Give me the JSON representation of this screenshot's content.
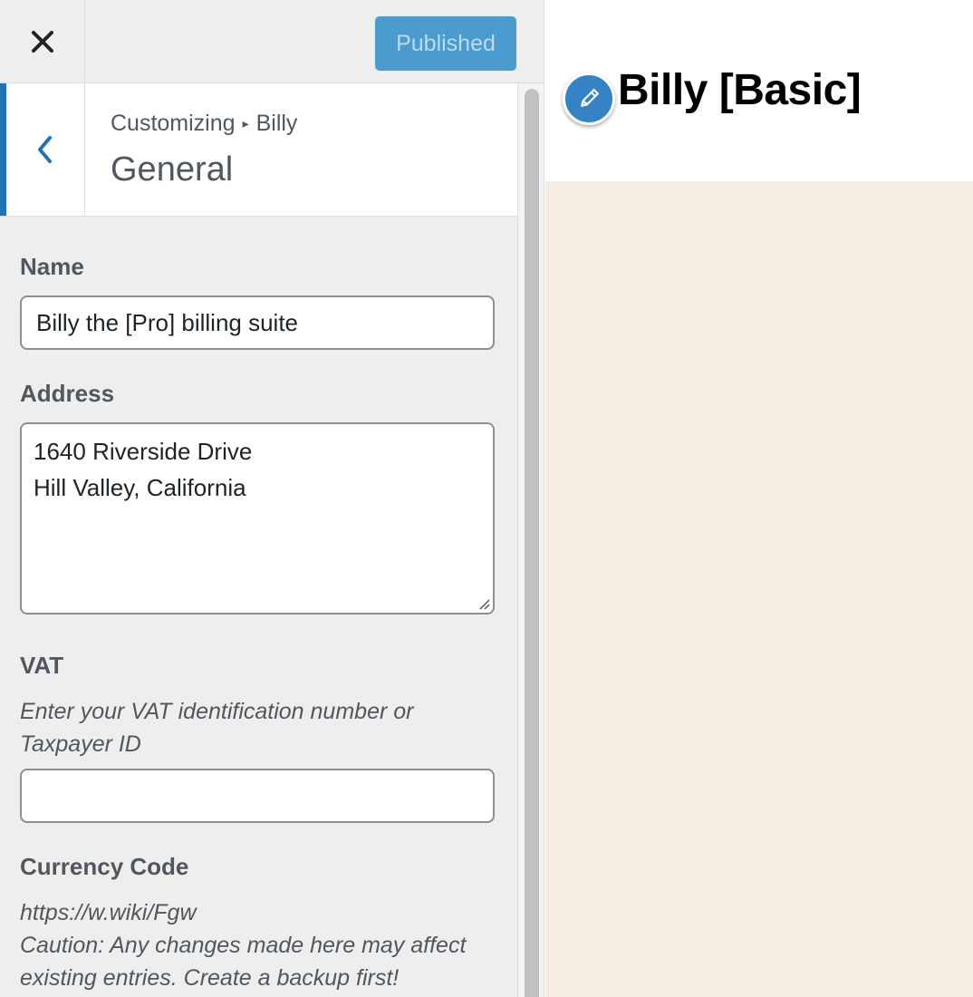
{
  "header": {
    "close_icon": "close-icon",
    "publish_label": "Published",
    "publish_color": "#4c9bcf"
  },
  "section": {
    "breadcrumb_parent": "Customizing",
    "breadcrumb_separator": "▸",
    "breadcrumb_current": "Billy",
    "title": "General",
    "back_icon": "chevron-left-icon",
    "accent_color": "#2271b1"
  },
  "fields": {
    "name": {
      "label": "Name",
      "value": "Billy the [Pro] billing suite"
    },
    "address": {
      "label": "Address",
      "line1": "1640 Riverside Drive",
      "line2": "Hill Valley, California"
    },
    "vat": {
      "label": "VAT",
      "description": "Enter your VAT identification number or Taxpayer ID",
      "value": ""
    },
    "currency": {
      "label": "Currency Code",
      "link": "https://w.wiki/Fgw",
      "caution": "Caution: Any changes made here may affect existing entries. Create a backup first!"
    }
  },
  "preview": {
    "site_title": "Billy [Basic]",
    "edit_icon": "pencil-icon",
    "background_color": "#f5ede3"
  }
}
